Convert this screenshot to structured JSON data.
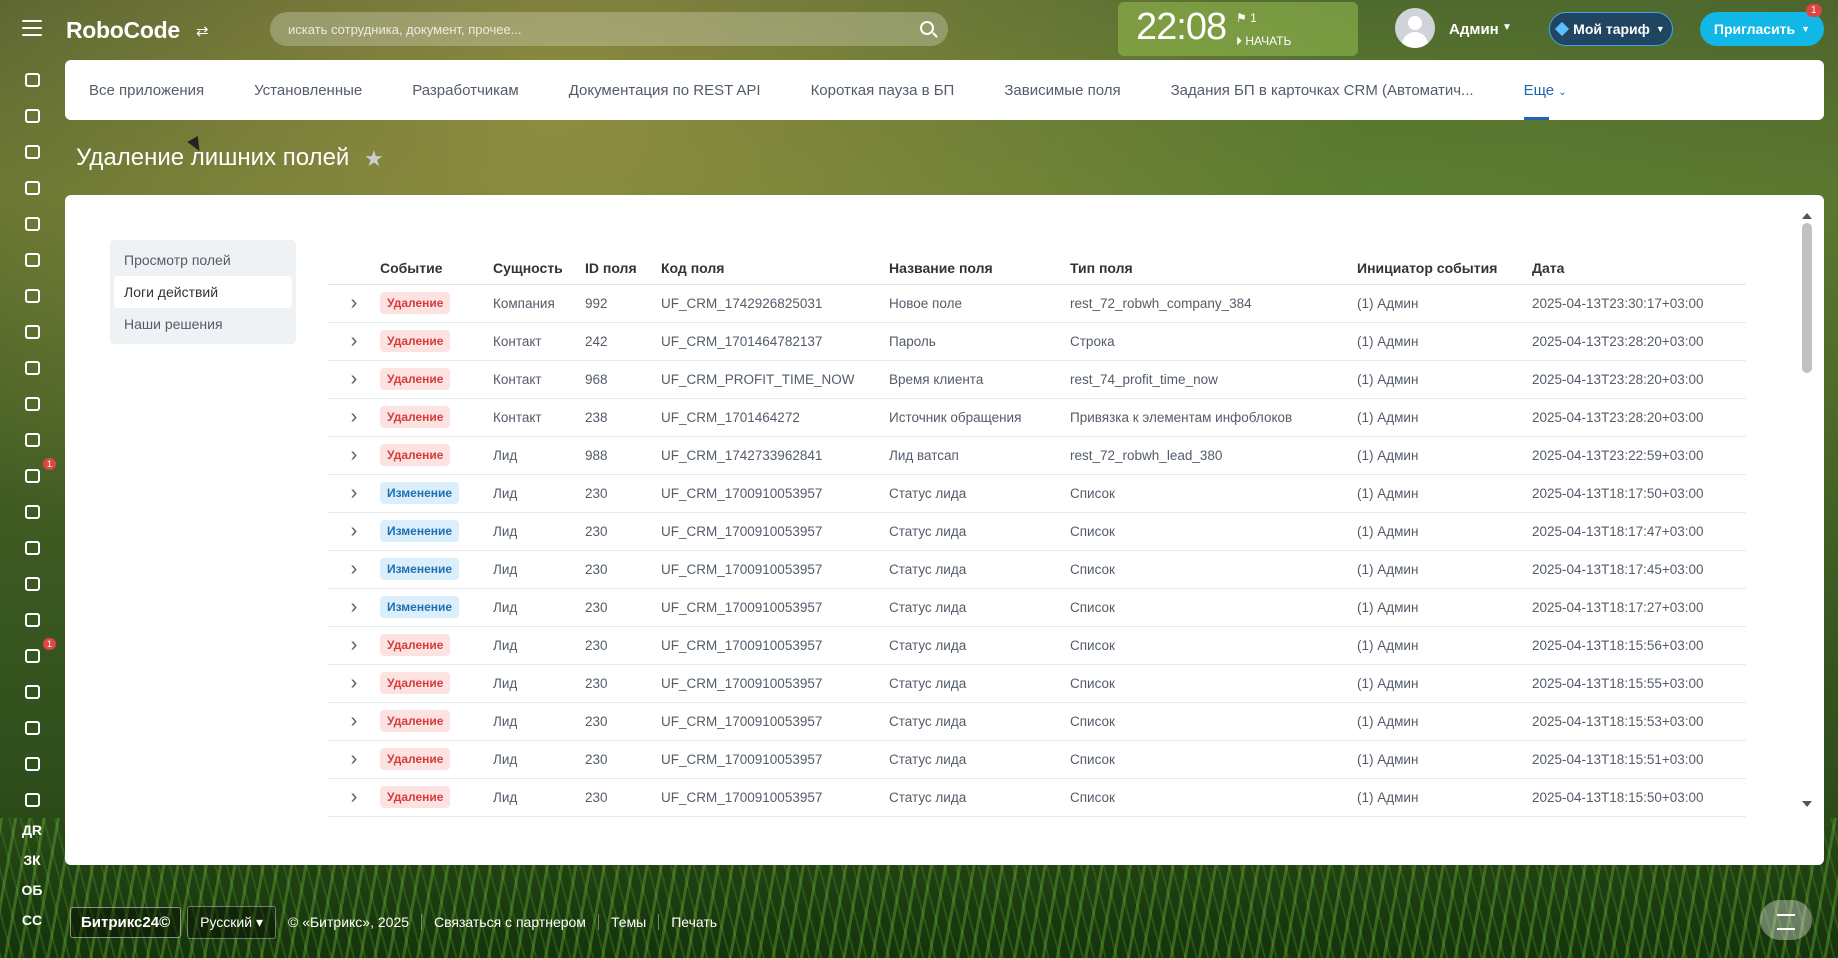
{
  "header": {
    "logo": "RoboCode",
    "search_placeholder": "искать сотрудника, документ, прочее...",
    "clock": "22:08",
    "clock_flag": "⚑ 1",
    "clock_start": "⏵ НАЧАТЬ",
    "user_name": "Админ",
    "tariff_label": "Мой тариф",
    "invite_label": "Пригласить",
    "invite_badge": "1"
  },
  "rail": {
    "badge_filter": "1",
    "badge_inbox": "1",
    "text_items": [
      "ДR",
      "ЗК",
      "ОБ",
      "СС"
    ]
  },
  "nav": {
    "items": [
      "Все приложения",
      "Установленные",
      "Разработчикам",
      "Документация по REST API",
      "Короткая пауза в БП",
      "Зависимые поля",
      "Задания БП в карточках CRM (Автоматич..."
    ],
    "more": "Еще"
  },
  "page": {
    "title": "Удаление лишних полей"
  },
  "side_menu": [
    "Просмотр полей",
    "Логи действий",
    "Наши решения"
  ],
  "table": {
    "headers": [
      "Событие",
      "Сущность",
      "ID поля",
      "Код поля",
      "Название поля",
      "Тип поля",
      "Инициатор события",
      "Дата"
    ],
    "rows": [
      {
        "event": "Удаление",
        "type": "del",
        "entity": "Компания",
        "id": "992",
        "code": "UF_CRM_1742926825031",
        "name": "Новое поле",
        "ftype": "rest_72_robwh_company_384",
        "init": "(1) Админ",
        "date": "2025-04-13T23:30:17+03:00"
      },
      {
        "event": "Удаление",
        "type": "del",
        "entity": "Контакт",
        "id": "242",
        "code": "UF_CRM_1701464782137",
        "name": "Пароль",
        "ftype": "Строка",
        "init": "(1) Админ",
        "date": "2025-04-13T23:28:20+03:00"
      },
      {
        "event": "Удаление",
        "type": "del",
        "entity": "Контакт",
        "id": "968",
        "code": "UF_CRM_PROFIT_TIME_NOW",
        "name": "Время клиента",
        "ftype": "rest_74_profit_time_now",
        "init": "(1) Админ",
        "date": "2025-04-13T23:28:20+03:00"
      },
      {
        "event": "Удаление",
        "type": "del",
        "entity": "Контакт",
        "id": "238",
        "code": "UF_CRM_1701464272",
        "name": "Источник обращения",
        "ftype": "Привязка к элементам инфоблоков",
        "init": "(1) Админ",
        "date": "2025-04-13T23:28:20+03:00"
      },
      {
        "event": "Удаление",
        "type": "del",
        "entity": "Лид",
        "id": "988",
        "code": "UF_CRM_1742733962841",
        "name": "Лид ватсап",
        "ftype": "rest_72_robwh_lead_380",
        "init": "(1) Админ",
        "date": "2025-04-13T23:22:59+03:00"
      },
      {
        "event": "Изменение",
        "type": "chg",
        "entity": "Лид",
        "id": "230",
        "code": "UF_CRM_1700910053957",
        "name": "Статус лида",
        "ftype": "Список",
        "init": "(1) Админ",
        "date": "2025-04-13T18:17:50+03:00"
      },
      {
        "event": "Изменение",
        "type": "chg",
        "entity": "Лид",
        "id": "230",
        "code": "UF_CRM_1700910053957",
        "name": "Статус лида",
        "ftype": "Список",
        "init": "(1) Админ",
        "date": "2025-04-13T18:17:47+03:00"
      },
      {
        "event": "Изменение",
        "type": "chg",
        "entity": "Лид",
        "id": "230",
        "code": "UF_CRM_1700910053957",
        "name": "Статус лида",
        "ftype": "Список",
        "init": "(1) Админ",
        "date": "2025-04-13T18:17:45+03:00"
      },
      {
        "event": "Изменение",
        "type": "chg",
        "entity": "Лид",
        "id": "230",
        "code": "UF_CRM_1700910053957",
        "name": "Статус лида",
        "ftype": "Список",
        "init": "(1) Админ",
        "date": "2025-04-13T18:17:27+03:00"
      },
      {
        "event": "Удаление",
        "type": "del",
        "entity": "Лид",
        "id": "230",
        "code": "UF_CRM_1700910053957",
        "name": "Статус лида",
        "ftype": "Список",
        "init": "(1) Админ",
        "date": "2025-04-13T18:15:56+03:00"
      },
      {
        "event": "Удаление",
        "type": "del",
        "entity": "Лид",
        "id": "230",
        "code": "UF_CRM_1700910053957",
        "name": "Статус лида",
        "ftype": "Список",
        "init": "(1) Админ",
        "date": "2025-04-13T18:15:55+03:00"
      },
      {
        "event": "Удаление",
        "type": "del",
        "entity": "Лид",
        "id": "230",
        "code": "UF_CRM_1700910053957",
        "name": "Статус лида",
        "ftype": "Список",
        "init": "(1) Админ",
        "date": "2025-04-13T18:15:53+03:00"
      },
      {
        "event": "Удаление",
        "type": "del",
        "entity": "Лид",
        "id": "230",
        "code": "UF_CRM_1700910053957",
        "name": "Статус лида",
        "ftype": "Список",
        "init": "(1) Админ",
        "date": "2025-04-13T18:15:51+03:00"
      },
      {
        "event": "Удаление",
        "type": "del",
        "entity": "Лид",
        "id": "230",
        "code": "UF_CRM_1700910053957",
        "name": "Статус лида",
        "ftype": "Список",
        "init": "(1) Админ",
        "date": "2025-04-13T18:15:50+03:00"
      }
    ]
  },
  "footer": {
    "b24": "Битрикс24©",
    "lang": "Русский ▾",
    "copyright": "© «Битрикс», 2025",
    "partner": "Связаться с партнером",
    "themes": "Темы",
    "print": "Печать"
  },
  "colors": {
    "delete_badge": "#fde2e2",
    "change_badge": "#dbeefb",
    "invite": "#11b8e6",
    "accent": "#2066b0"
  }
}
